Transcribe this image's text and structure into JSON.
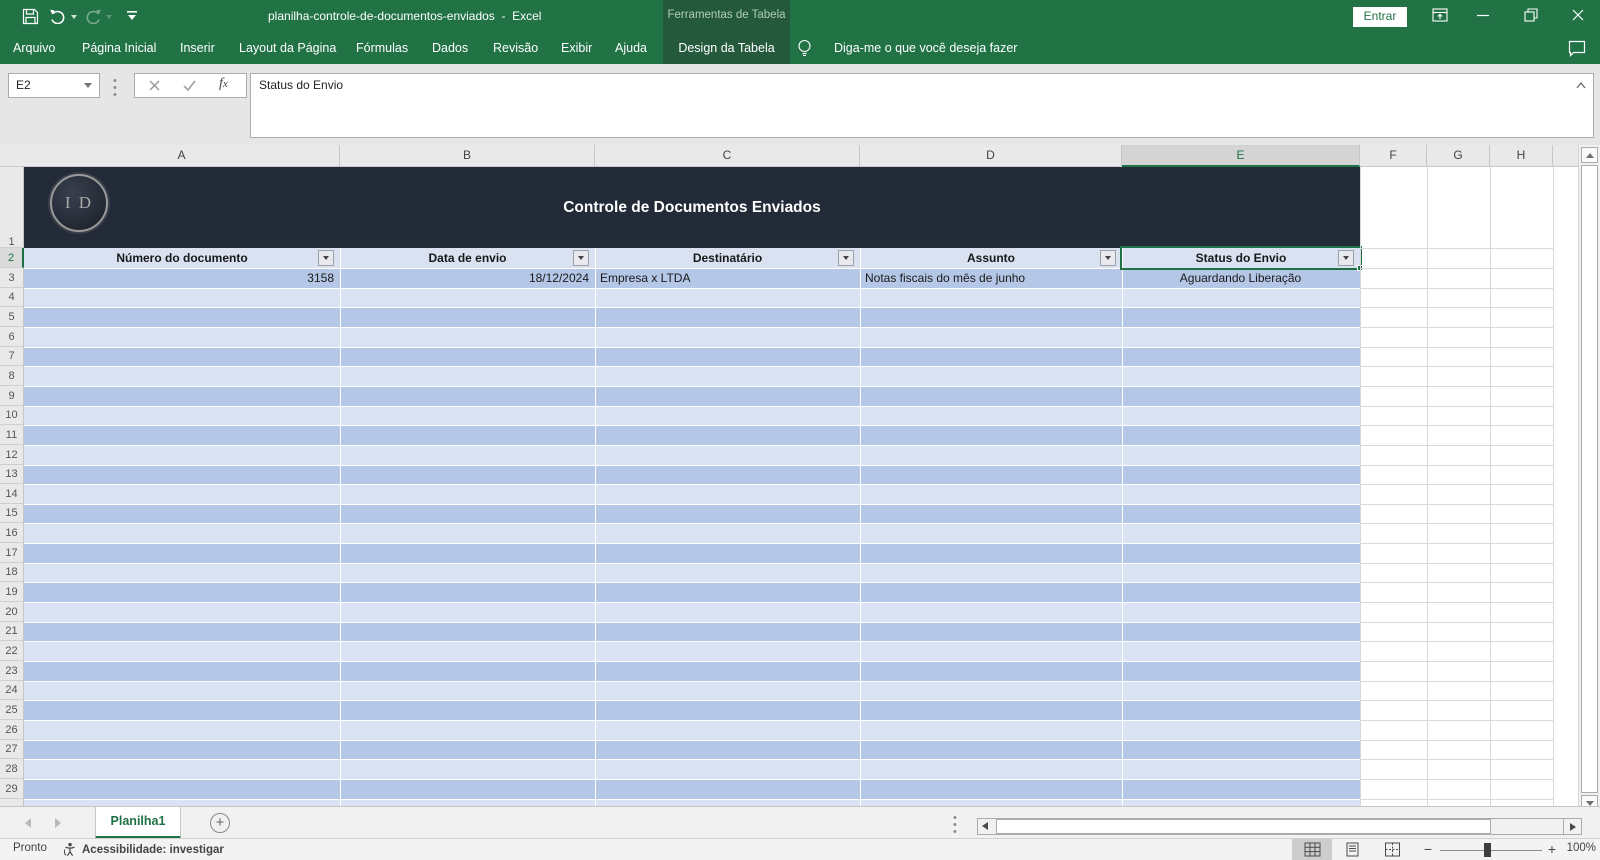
{
  "window": {
    "title": "planilha-controle-de-documentos-enviados  -  Excel",
    "signin_label": "Entrar"
  },
  "ribbon": {
    "tabs": [
      "Arquivo",
      "Página Inicial",
      "Inserir",
      "Layout da Página",
      "Fórmulas",
      "Dados",
      "Revisão",
      "Exibir",
      "Ajuda"
    ],
    "contextual_group": "Ferramentas de Tabela",
    "contextual_tab": "Design da Tabela",
    "tell_me": "Diga-me o que você deseja fazer"
  },
  "formula_bar": {
    "name_box": "E2",
    "value": "Status do Envio"
  },
  "sheet": {
    "columns": [
      "A",
      "B",
      "C",
      "D",
      "E",
      "F",
      "G",
      "H"
    ],
    "selected_column": "E",
    "selected_cell": "E2",
    "rows_visible": 29,
    "banner": {
      "logo": "I D",
      "title": "Controle de Documentos Enviados"
    },
    "table": {
      "headers": [
        "Número do documento",
        "Data de envio",
        "Destinatário",
        "Assunto",
        "Status do Envio"
      ],
      "rows": [
        [
          "3158",
          "18/12/2024",
          "Empresa x LTDA",
          "Notas fiscais do mês de junho",
          "Aguardando Liberação"
        ]
      ]
    }
  },
  "sheet_tabs": {
    "active": "Planilha1"
  },
  "status_bar": {
    "mode": "Pronto",
    "accessibility": "Acessibilidade: investigar",
    "zoom": "100%"
  },
  "colors": {
    "titlebar_green": "#217346",
    "contextual_block_green": "#25593C",
    "banner_bg": "#232B38",
    "table_header_bg": "#DAE2F1",
    "band_dark": "#B5C7E6",
    "band_light": "#DAE3F3",
    "selection_green": "#1E7145"
  }
}
